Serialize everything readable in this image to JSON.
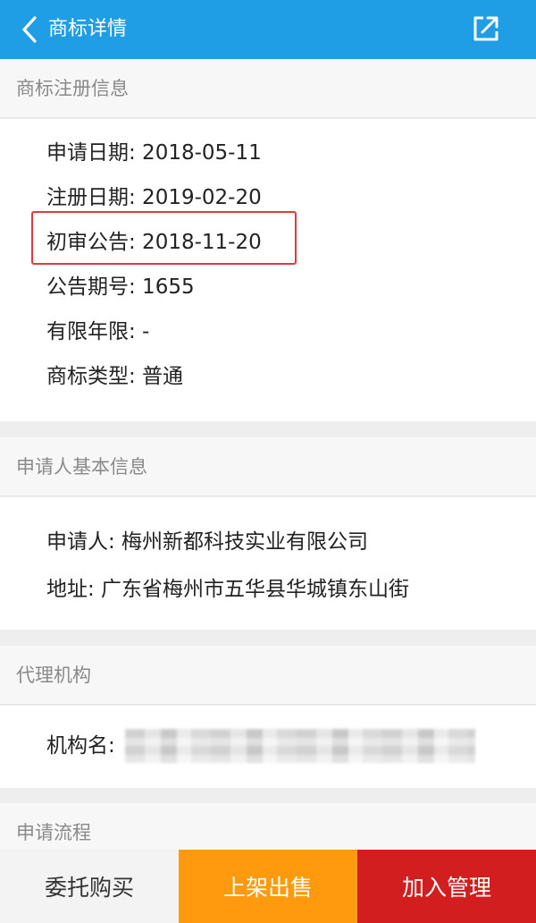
{
  "nav": {
    "title": "商标详情",
    "back_icon": "chevron-left-icon",
    "share_icon": "share-external-icon"
  },
  "registration": {
    "header": "商标注册信息",
    "apply_date": "申请日期: 2018-05-11",
    "register_date": "注册日期: 2019-02-20",
    "preliminary_notice": "初审公告: 2018-11-20",
    "notice_issue": "公告期号: 1655",
    "validity": "有限年限: -",
    "type": "商标类型: 普通"
  },
  "applicant": {
    "header": "申请人基本信息",
    "name": "申请人: 梅州新都科技实业有限公司",
    "address": "地址: 广东省梅州市五华县华城镇东山街"
  },
  "agency": {
    "header": "代理机构",
    "name_label": "机构名:"
  },
  "process": {
    "header": "申请流程"
  },
  "actions": {
    "entrust": "委托购买",
    "sell": "上架出售",
    "manage": "加入管理"
  },
  "colors": {
    "nav_bg": "#1f9ee6",
    "sell_bg": "#ff9a0e",
    "manage_bg": "#d21e1e",
    "highlight_border": "#e03a3a"
  }
}
